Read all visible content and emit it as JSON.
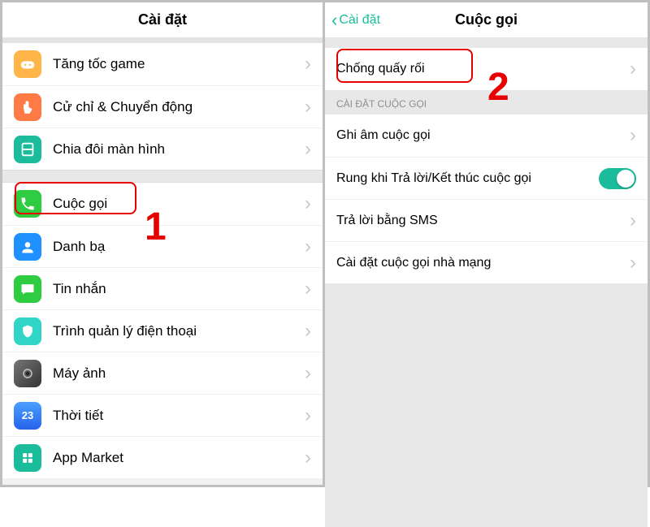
{
  "left": {
    "title": "Cài đặt",
    "items": [
      {
        "key": "game-boost",
        "label": "Tăng tốc game",
        "icon": "game",
        "bg": "#ffb547"
      },
      {
        "key": "gesture",
        "label": "Cử chỉ & Chuyển động",
        "icon": "finger",
        "bg": "#ff7a45"
      },
      {
        "key": "split",
        "label": "Chia đôi màn hình",
        "icon": "split",
        "bg": "#1abc9c"
      },
      {
        "key": "call",
        "label": "Cuộc gọi",
        "icon": "phone",
        "bg": "#2ecc40"
      },
      {
        "key": "contacts",
        "label": "Danh bạ",
        "icon": "user",
        "bg": "#1e90ff"
      },
      {
        "key": "messages",
        "label": "Tin nhắn",
        "icon": "msg",
        "bg": "#2ecc40"
      },
      {
        "key": "phonemgr",
        "label": "Trình quản lý điện thoại",
        "icon": "shield",
        "bg": "#30d5c8"
      },
      {
        "key": "camera",
        "label": "Máy ảnh",
        "icon": "camera",
        "bg": "#555"
      },
      {
        "key": "weather",
        "label": "Thời tiết",
        "icon": "weather",
        "bg": "#3b82f6",
        "badge": "23"
      },
      {
        "key": "appmarket",
        "label": "App Market",
        "icon": "market",
        "bg": "#1abc9c"
      }
    ]
  },
  "right": {
    "back": "Cài đặt",
    "title": "Cuộc gọi",
    "group1": [
      {
        "key": "anti-harass",
        "label": "Chống quấy rối"
      }
    ],
    "section_header": "CÀI ĐẶT CUỘC GỌI",
    "group2": [
      {
        "key": "record",
        "label": "Ghi âm cuộc gọi",
        "type": "nav"
      },
      {
        "key": "vibrate",
        "label": "Rung khi Trả lời/Kết thúc cuộc gọi",
        "type": "toggle",
        "on": true
      },
      {
        "key": "sms",
        "label": "Trả lời bằng SMS",
        "type": "nav"
      },
      {
        "key": "carrier",
        "label": "Cài đặt cuộc gọi nhà mạng",
        "type": "nav"
      }
    ]
  },
  "annotations": {
    "one": "1",
    "two": "2"
  }
}
